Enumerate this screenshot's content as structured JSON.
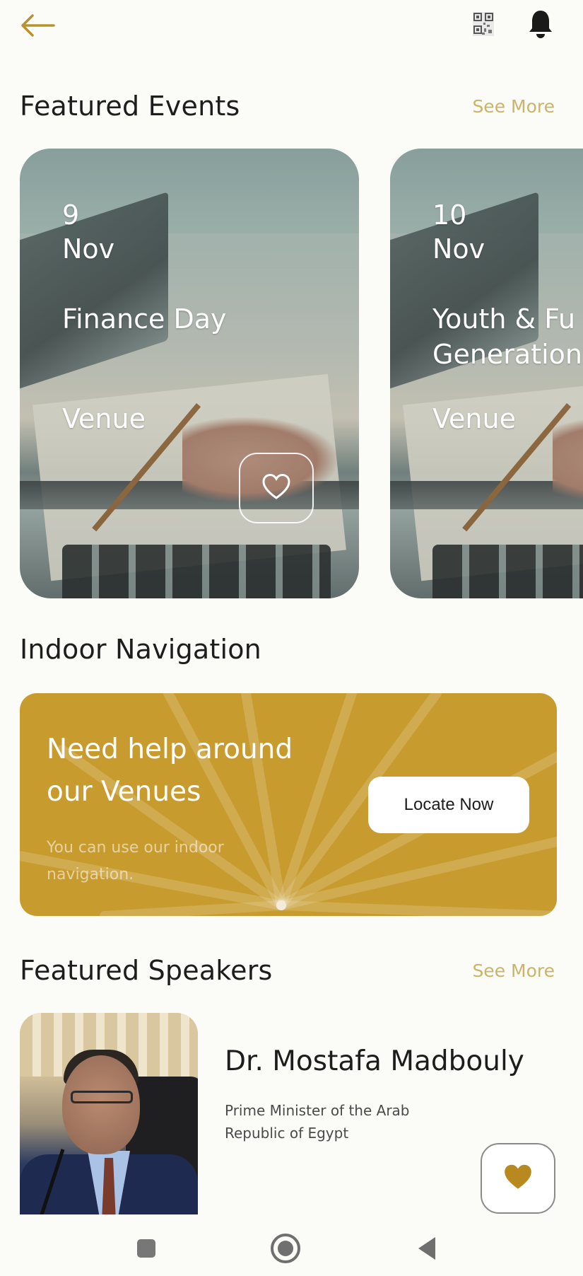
{
  "colors": {
    "accent_gold": "#c79b2e",
    "see_more": "#c9b46a",
    "back_arrow": "#b8922e",
    "heart_fill": "#b8891f"
  },
  "topbar": {
    "back_icon": "arrow-left-icon",
    "qr_icon": "qr-code-icon",
    "bell_icon": "bell-icon"
  },
  "featured_events": {
    "title": "Featured Events",
    "see_more": "See More",
    "events": [
      {
        "day": "9",
        "month": "Nov",
        "name": "Finance Day",
        "venue": "Venue"
      },
      {
        "day": "10",
        "month": "Nov",
        "name": "Youth & Fu Generation",
        "venue": "Venue"
      }
    ]
  },
  "indoor_navigation": {
    "title": "Indoor Navigation",
    "headline": "Need help around our Venues",
    "subtitle": "You can use our indoor navigation.",
    "button": "Locate Now"
  },
  "featured_speakers": {
    "title": "Featured Speakers",
    "see_more": "See More",
    "speakers": [
      {
        "name": "Dr. Mostafa Madbouly",
        "role": "Prime Minister of the Arab Republic of Egypt"
      }
    ]
  },
  "system_nav": {
    "recents_icon": "square-icon",
    "home_icon": "circle-home-icon",
    "back_icon": "triangle-back-icon"
  }
}
